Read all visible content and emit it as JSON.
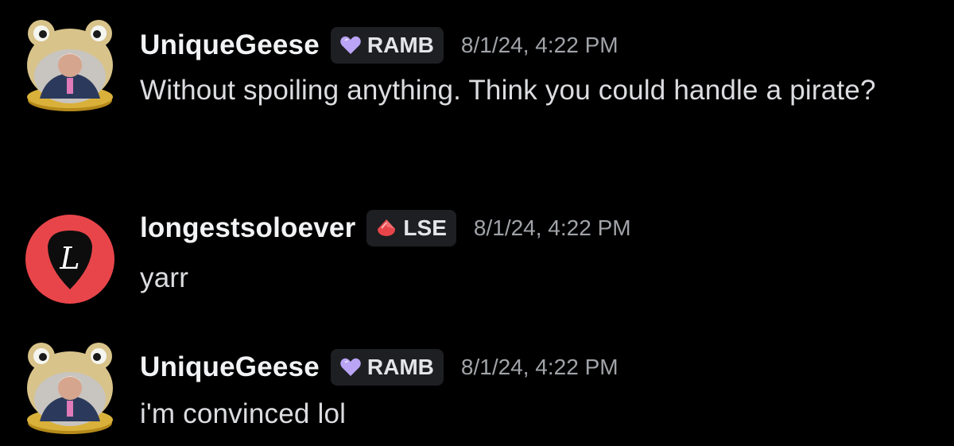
{
  "messages": [
    {
      "username": "UniqueGeese",
      "tag": "RAMB",
      "tag_icon": "purple-heart-icon",
      "tag_color": "#b9a4f5",
      "timestamp": "8/1/24, 4:22 PM",
      "text": "Without spoiling anything. Think you could handle a pirate?",
      "avatar": "frog-hat-avatar"
    },
    {
      "username": "longestsoloever",
      "tag": "LSE",
      "tag_icon": "red-gem-icon",
      "tag_color": "#e8454a",
      "timestamp": "8/1/24, 4:22 PM",
      "text": "yarr",
      "avatar": "guitar-pick-avatar",
      "avatar_letter": "L"
    },
    {
      "username": "UniqueGeese",
      "tag": "RAMB",
      "tag_icon": "purple-heart-icon",
      "tag_color": "#b9a4f5",
      "timestamp": "8/1/24, 4:22 PM",
      "text": "i'm convinced lol",
      "avatar": "frog-hat-avatar"
    }
  ],
  "colors": {
    "background": "#000000",
    "username": "#f2f3f5",
    "message_text": "#dcdde0",
    "timestamp": "#a0a3a8",
    "tag_background": "#1e1f22"
  }
}
